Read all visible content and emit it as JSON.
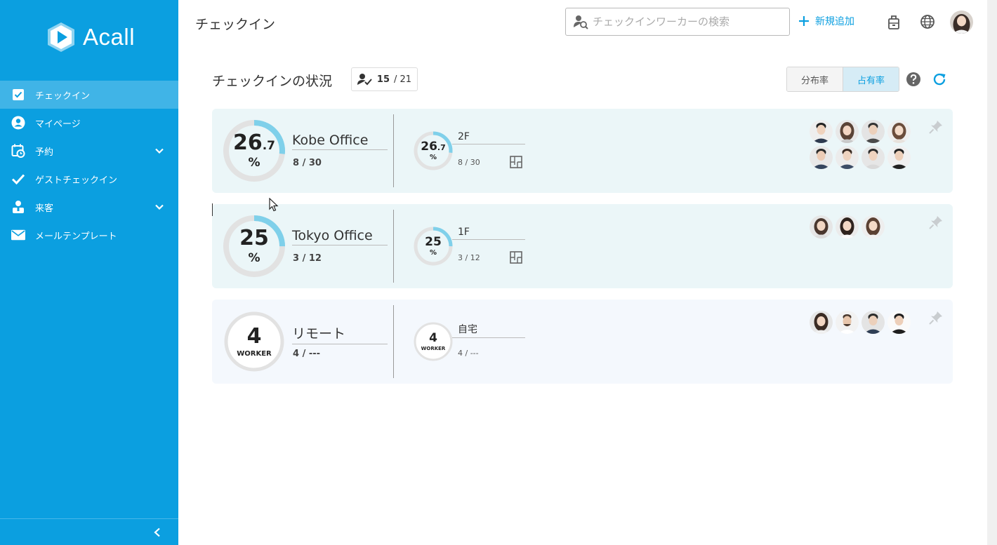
{
  "app": {
    "logo_text": "Acall"
  },
  "sidebar": {
    "items": [
      {
        "label": "チェックイン",
        "icon": "checkbox-icon",
        "active": true
      },
      {
        "label": "マイページ",
        "icon": "user-circle-icon"
      },
      {
        "label": "予約",
        "icon": "calendar-clock-icon",
        "expandable": true
      },
      {
        "label": "ゲストチェックイン",
        "icon": "check-icon"
      },
      {
        "label": "来客",
        "icon": "visitor-icon",
        "expandable": true
      },
      {
        "label": "メールテンプレート",
        "icon": "mail-icon"
      }
    ]
  },
  "header": {
    "title": "チェックイン",
    "search_placeholder": "チェックインワーカーの検索",
    "add_new_label": "新規追加"
  },
  "status": {
    "title": "チェックインの状況",
    "checked_in": "15",
    "total": "/ 21",
    "toggle": {
      "distribution_label": "分布率",
      "occupancy_label": "占有率",
      "selected": "occupancy"
    }
  },
  "colors": {
    "accent": "#0b9fe0",
    "ring_fill": "#7fd0ea",
    "ring_track": "#e2e2e2"
  },
  "cards": [
    {
      "name": "Kobe Office",
      "rate_int": "26",
      "rate_dec": ".7",
      "unit": "%",
      "rate_value": 26.7,
      "count": "8 / 30",
      "floor": {
        "name": "2F",
        "rate_int": "26",
        "rate_dec": ".7",
        "unit": "%",
        "rate_value": 26.7,
        "count": "8 / 30"
      },
      "avatar_count": 8
    },
    {
      "name": "Tokyo Office",
      "rate_int": "25",
      "rate_dec": "",
      "unit": "%",
      "rate_value": 25,
      "count": "3 / 12",
      "floor": {
        "name": "1F",
        "rate_int": "25",
        "rate_dec": "",
        "unit": "%",
        "rate_value": 25,
        "count": "3 / 12"
      },
      "avatar_count": 3
    },
    {
      "name": "リモート",
      "workers": "4",
      "unit": "WORKER",
      "count": "4 / ---",
      "floor": {
        "name": "自宅",
        "workers": "4",
        "unit": "WORKER",
        "count": "4 / ---"
      },
      "avatar_count": 4
    }
  ]
}
